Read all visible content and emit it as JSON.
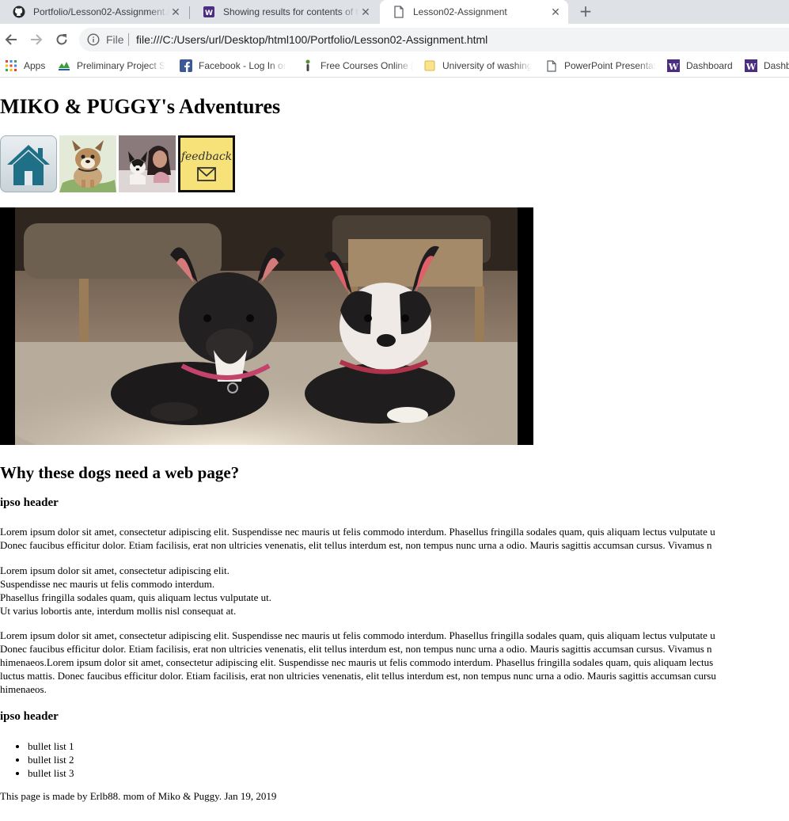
{
  "browser": {
    "tabs": [
      {
        "title": "Portfolio/Lesson02-Assignment.h",
        "icon": "github-icon",
        "active": false
      },
      {
        "title": "Showing results for contents of t",
        "icon": "bookmark-app-icon",
        "active": false
      },
      {
        "title": "Lesson02-Assignment",
        "icon": "page-icon",
        "active": true
      }
    ],
    "new_tab_label": "+",
    "address": {
      "scheme_label": "File",
      "url": "file:///C:/Users/url/Desktop/html100/Portfolio/Lesson02-Assignment.html"
    },
    "bookmarks": [
      {
        "label": "Apps",
        "icon": "apps-grid-icon"
      },
      {
        "label": "Preliminary Project S",
        "icon": "project-icon"
      },
      {
        "label": "Facebook - Log In or",
        "icon": "facebook-icon"
      },
      {
        "label": "Free Courses Online |",
        "icon": "courses-icon"
      },
      {
        "label": "University of washing",
        "icon": "folder-icon"
      },
      {
        "label": "PowerPoint Presentat",
        "icon": "page-icon"
      },
      {
        "label": "Dashboard",
        "icon": "uw-icon"
      },
      {
        "label": "Dashb",
        "icon": "uw-icon"
      }
    ]
  },
  "page": {
    "title": "MIKO & PUGGY's Adventures",
    "nav_icons": [
      "home-icon",
      "bulldog-cartoon-icon",
      "owner-with-dog-photo-icon",
      "feedback-note-icon"
    ],
    "feedback_note_text": "feedback",
    "section_heading": "Why these dogs need a web page?",
    "sub_heading_1": "ipso header",
    "paragraph_1": [
      "Lorem ipsum dolor sit amet, consectetur adipiscing elit. Suspendisse nec mauris ut felis commodo interdum. Phasellus fringilla sodales quam, quis aliquam lectus vulputate u",
      "Donec faucibus efficitur dolor. Etiam facilisis, erat non ultricies venenatis, elit tellus interdum est, non tempus nunc urna a odio. Mauris sagittis accumsan cursus. Vivamus n"
    ],
    "paragraph_2": [
      "Lorem ipsum dolor sit amet, consectetur adipiscing elit.",
      "Suspendisse nec mauris ut felis commodo interdum.",
      "Phasellus fringilla sodales quam, quis aliquam lectus vulputate ut.",
      "Ut varius lobortis ante, interdum mollis nisl consequat at."
    ],
    "paragraph_3": [
      "Lorem ipsum dolor sit amet, consectetur adipiscing elit. Suspendisse nec mauris ut felis commodo interdum. Phasellus fringilla sodales quam, quis aliquam lectus vulputate u",
      "Donec faucibus efficitur dolor. Etiam facilisis, erat non ultricies venenatis, elit tellus interdum est, non tempus nunc urna a odio. Mauris sagittis accumsan cursus. Vivamus n",
      "himenaeos.Lorem ipsum dolor sit amet, consectetur adipiscing elit. Suspendisse nec mauris ut felis commodo interdum. Phasellus fringilla sodales quam, quis aliquam lectus",
      "luctus mattis. Donec faucibus efficitur dolor. Etiam facilisis, erat non ultricies venenatis, elit tellus interdum est, non tempus nunc urna a odio. Mauris sagittis accumsan cursu",
      "himenaeos."
    ],
    "sub_heading_2": "ipso header",
    "bullets": [
      "bullet list 1",
      "bullet list 2",
      "bullet list 3"
    ],
    "footer": "This page is made by Erlb88. mom of Miko & Puggy. Jan 19, 2019"
  },
  "colors": {
    "tabstrip_bg": "#dee1e6",
    "omnibox_bg": "#f1f3f4",
    "home_icon_teal": "#1f6f86",
    "feedback_note_yellow": "#f7e27a"
  }
}
